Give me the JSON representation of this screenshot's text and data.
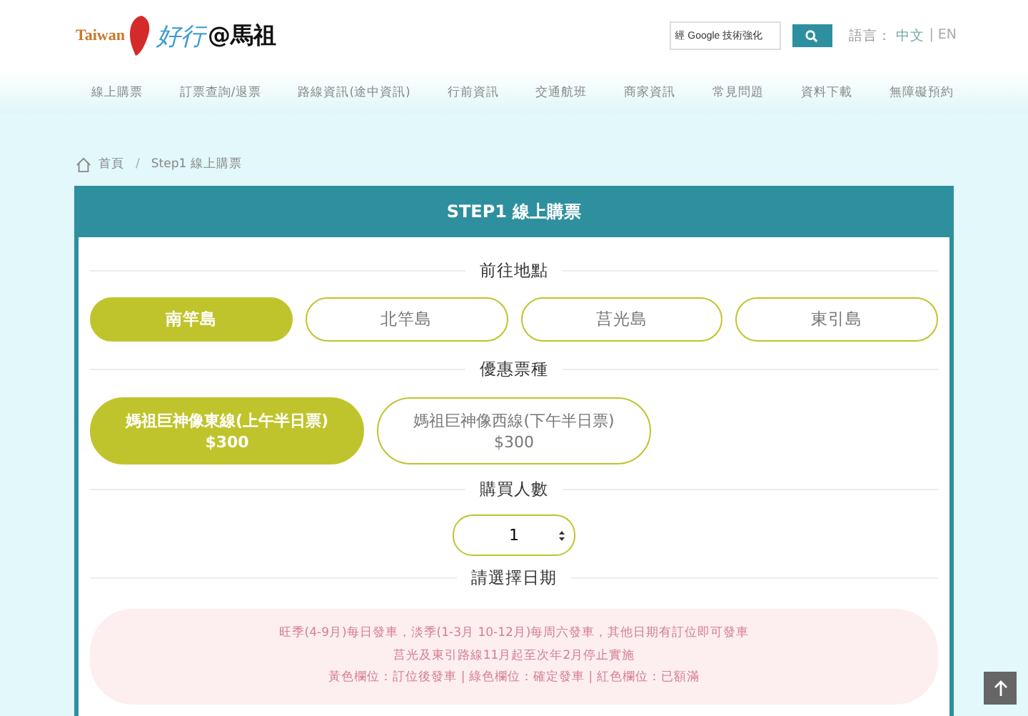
{
  "header": {
    "logo": {
      "taiwan": "Taiwan",
      "name": "好行",
      "place": "@馬祖"
    },
    "search": {
      "placeholder": "經 Google 技術強化"
    },
    "language": {
      "label": "語言：",
      "separator": "|",
      "options": [
        {
          "label": "中文",
          "selected": true
        },
        {
          "label": "EN",
          "selected": false
        }
      ]
    }
  },
  "nav": [
    "線上購票",
    "訂票查詢/退票",
    "路線資訊(途中資訊)",
    "行前資訊",
    "交通航班",
    "商家資訊",
    "常見問題",
    "資料下載",
    "無障礙預約"
  ],
  "breadcrumb": [
    "首頁",
    "Step1 線上購票"
  ],
  "breadcrumb_separator": "/",
  "card": {
    "title": "STEP1 線上購票",
    "destination": {
      "heading": "前往地點",
      "options": [
        {
          "label": "南竿島",
          "selected": true
        },
        {
          "label": "北竿島",
          "selected": false
        },
        {
          "label": "莒光島",
          "selected": false
        },
        {
          "label": "東引島",
          "selected": false
        }
      ]
    },
    "ticket": {
      "heading": "優惠票種",
      "options": [
        {
          "label": "媽祖巨神像東線(上午半日票)",
          "price": "$300",
          "selected": true
        },
        {
          "label": "媽祖巨神像西線(下午半日票)",
          "price": "$300",
          "selected": false
        }
      ]
    },
    "people": {
      "heading": "購買人數",
      "value": "1"
    },
    "date": {
      "heading": "請選擇日期",
      "notes": [
        "旺季(4-9月)每日發車，淡季(1-3月 10-12月)每周六發車，其他日期有訂位即可發車",
        "莒光及東引路線11月起至次年2月停止實施",
        "黃色欄位：訂位後發車 | 綠色欄位：確定發車 | 紅色欄位：已額滿"
      ]
    }
  }
}
